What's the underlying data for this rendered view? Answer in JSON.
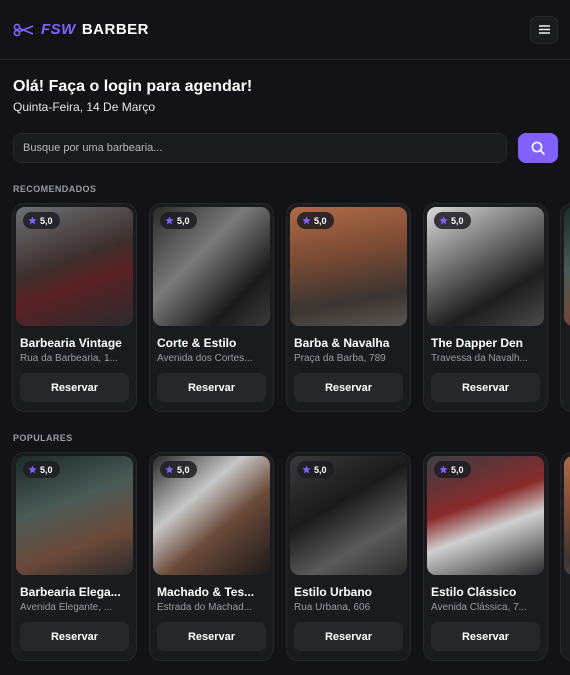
{
  "brand": {
    "fsw": "FSW",
    "barber": "BARBER"
  },
  "greeting": {
    "title": "Olá! Faça o login para agendar!",
    "date": "Quinta-Feira, 14 De Março"
  },
  "search": {
    "placeholder": "Busque por uma barbearia..."
  },
  "recommended": {
    "title": "RECOMENDADOS",
    "cards": [
      {
        "name": "Barbearia Vintage",
        "address": "Rua da Barbearia, 1...",
        "rating": "5,0",
        "button": "Reservar"
      },
      {
        "name": "Corte & Estilo",
        "address": "Avenida dos Cortes...",
        "rating": "5,0",
        "button": "Reservar"
      },
      {
        "name": "Barba & Navalha",
        "address": "Praça da Barba, 789",
        "rating": "5,0",
        "button": "Reservar"
      },
      {
        "name": "The Dapper Den",
        "address": "Travessa da Navalh...",
        "rating": "5,0",
        "button": "Reservar"
      }
    ]
  },
  "popular": {
    "title": "POPULARES",
    "cards": [
      {
        "name": "Barbearia Elega...",
        "address": "Avenida Elegante, ...",
        "rating": "5,0",
        "button": "Reservar"
      },
      {
        "name": "Machado & Tes...",
        "address": "Estrada do Machad...",
        "rating": "5,0",
        "button": "Reservar"
      },
      {
        "name": "Estilo Urbano",
        "address": "Rua Urbana, 606",
        "rating": "5,0",
        "button": "Reservar"
      },
      {
        "name": "Estilo Clássico",
        "address": "Avenida Clássica, 7...",
        "rating": "5,0",
        "button": "Reservar"
      }
    ]
  },
  "colors": {
    "accent": "#8162ff",
    "background": "#121217",
    "card": "#1a1b1f",
    "border": "#26272b"
  },
  "icons": {
    "logo": "scissors-icon",
    "menu": "menu-icon",
    "search": "search-icon",
    "rating": "star-icon"
  }
}
